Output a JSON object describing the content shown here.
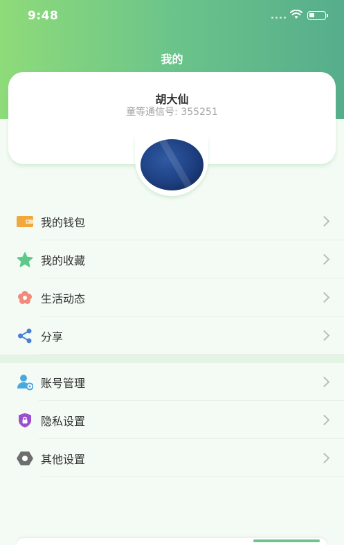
{
  "status_bar": {
    "time": "9:48"
  },
  "header": {
    "title": "我的"
  },
  "profile": {
    "name": "胡大仙",
    "id_text": "童等通信号: 355251"
  },
  "menu_group_1": [
    {
      "label": "我的钱包",
      "icon": "wallet-icon",
      "color": "#f0a83c"
    },
    {
      "label": "我的收藏",
      "icon": "star-icon",
      "color": "#5cc98a"
    },
    {
      "label": "生活动态",
      "icon": "flower-icon",
      "color": "#f08a7c"
    },
    {
      "label": "分享",
      "icon": "share-icon",
      "color": "#4a7fd6"
    }
  ],
  "menu_group_2": [
    {
      "label": "账号管理",
      "icon": "account-settings-icon",
      "color": "#4aa8e0"
    },
    {
      "label": "隐私设置",
      "icon": "privacy-shield-icon",
      "color": "#9b4fd0"
    },
    {
      "label": "其他设置",
      "icon": "gear-icon",
      "color": "#6e6e6e"
    }
  ],
  "colors": {
    "header_gradient_start": "#8fdb7a",
    "header_gradient_end": "#56ad8c",
    "page_background": "#f4fbf4"
  }
}
